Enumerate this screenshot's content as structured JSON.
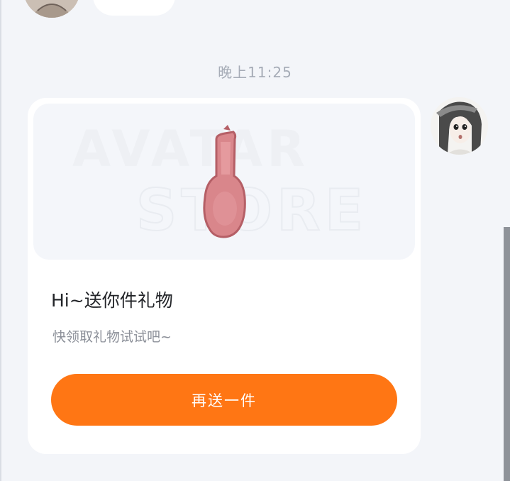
{
  "chat": {
    "timestamp": "晚上11:25"
  },
  "gift_card": {
    "watermark_text": "AVATAR STORE",
    "gift_item": "guitar-case",
    "title": "Hi~送你件礼物",
    "subtitle": "快领取礼物试试吧~",
    "button_label": "再送一件"
  },
  "colors": {
    "background": "#f3f5f9",
    "card": "#ffffff",
    "accent": "#ff7614",
    "timestamp": "#a6acb7",
    "gift_case": "#d77f85"
  }
}
